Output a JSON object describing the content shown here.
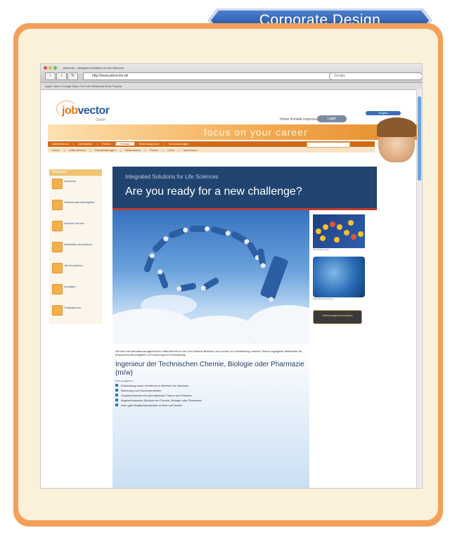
{
  "header": {
    "title": "Corporate Design"
  },
  "browser": {
    "window_title": "jobvector - Integrated Solutions for Life Sciences",
    "url": "http://www.jobvector.de",
    "search_placeholder": "Google",
    "bookmarks": "Apple   Yahoo!   Google Maps   YouTube   Wikipedia   News   Popular"
  },
  "site": {
    "logo_job": "job",
    "logo_vector": "vector",
    "logo_sub": "GmbH",
    "header_links": "Home   Kontakt   Impressum",
    "header_badge": "Login",
    "header_pill": "English",
    "slogan": "focus on your career",
    "nav_primary": [
      "Arbeitnehmer",
      "Arbeitgeber",
      "Partner",
      "Kontakt",
      "Stellenangebote",
      "Veranstaltungen"
    ],
    "nav_primary_active": "Kontakt",
    "nav_secondary": [
      "Home",
      "Unternehmen",
      "Dienstleistungen",
      "Stellenmarkt",
      "Presse",
      "Links",
      "Impressum"
    ],
    "sidebar_heading": "Shortcuts",
    "sidebar": [
      "Jobvector",
      "Stellenmarkt Arbeitgeber",
      "Karriere Service",
      "Newsletter abonnieren",
      "Job Empfehlen",
      "Anzeigen",
      "Publikationen"
    ],
    "content_subtitle": "Integrated Solutions for Life Sciences",
    "content_heading": "Are you ready for a new challenge?",
    "intro_text": "Wir sind ein international agierendes Unternehmen in der Life-Science-Branche und suchen zur Verstärkung unseres Teams engagierte Mitarbeiter für anspruchsvolle Aufgaben in Forschung und Entwicklung.",
    "job_title": "Ingenieur der Technischen Chemie, Biologie oder Pharmazie (m/w)",
    "job_meta": "Ihre Aufgaben:",
    "bullets": [
      "Entwicklung neuer Verfahren im Bereich Life Sciences",
      "Betreuung von Kundenprojekten",
      "Zusammenarbeit mit internationalen Teams und Partnern",
      "Abgeschlossenes Studium der Chemie, Biologie oder Pharmazie",
      "Sehr gute Englischkenntnisse in Wort und Schrift"
    ],
    "teaser1_caption": "Life Science Jobs",
    "teaser2_caption": "Internationale Karriere",
    "gold_button": "Stellenangebot ansehen"
  },
  "colors": {
    "accent_orange": "#f2a05a",
    "panel": "#fbf0d9",
    "tab_blue": "#2e5fae",
    "content_navy": "#20446f"
  }
}
